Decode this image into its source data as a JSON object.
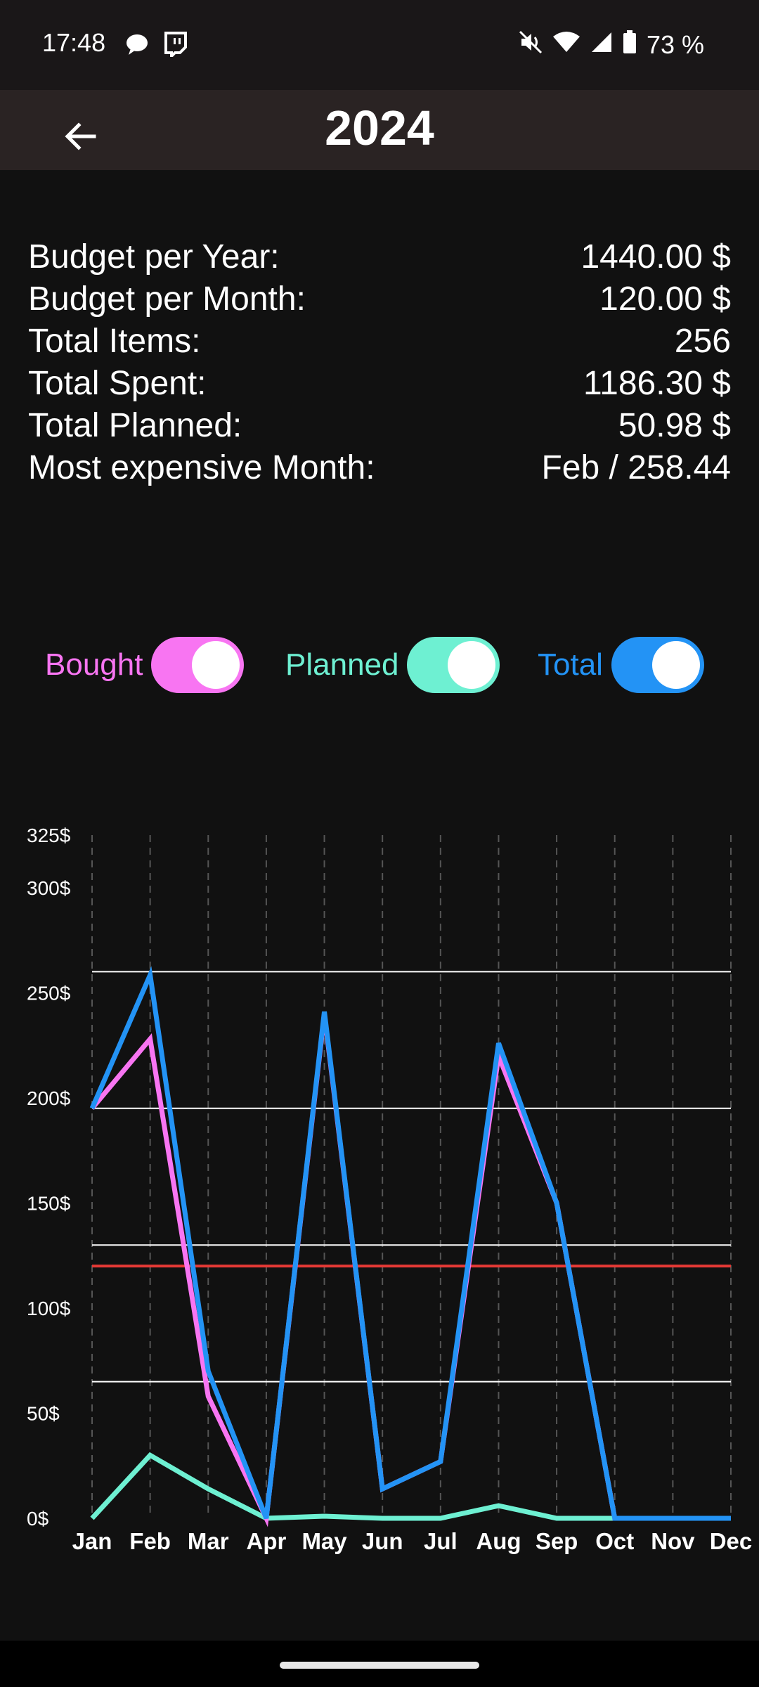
{
  "status": {
    "time": "17:48",
    "battery": "73 %"
  },
  "header": {
    "title": "2024",
    "back_icon": "arrow-left-icon"
  },
  "stats": [
    {
      "label": "Budget per Year:",
      "value": "1440.00 $"
    },
    {
      "label": "Budget per Month:",
      "value": "120.00 $"
    },
    {
      "label": "Total Items:",
      "value": "256"
    },
    {
      "label": "Total Spent:",
      "value": "1186.30 $"
    },
    {
      "label": "Total Planned:",
      "value": "50.98 $"
    },
    {
      "label": "Most expensive Month:",
      "value": "Feb / 258.44"
    }
  ],
  "toggles": [
    {
      "label": "Bought",
      "on": true,
      "color": "#f875f2",
      "track": "#f875f2"
    },
    {
      "label": "Planned",
      "on": true,
      "color": "#6ef0d2",
      "track": "#6ef0d2"
    },
    {
      "label": "Total",
      "on": true,
      "color": "#2393f5",
      "track": "#2393f5"
    }
  ],
  "colors": {
    "bought": "#f875f2",
    "planned": "#6ef0d2",
    "total": "#2393f5",
    "budget_line": "#e53935"
  },
  "chart_data": {
    "type": "line",
    "x": [
      "Jan",
      "Feb",
      "Mar",
      "Apr",
      "May",
      "Jun",
      "Jul",
      "Aug",
      "Sep",
      "Oct",
      "Nov",
      "Dec"
    ],
    "ylim": [
      0,
      325
    ],
    "y_ticks": [
      "0$",
      "50$",
      "100$",
      "150$",
      "200$",
      "250$",
      "300$",
      "325$"
    ],
    "y_tick_values": [
      0,
      50,
      100,
      150,
      200,
      250,
      300,
      325
    ],
    "reference_lines": [
      65,
      130,
      195,
      260
    ],
    "budget_line": 120,
    "grid": true,
    "series": [
      {
        "name": "Bought",
        "values": [
          195,
          228,
          58,
          0,
          240,
          14,
          27,
          220,
          150,
          0,
          0,
          0
        ]
      },
      {
        "name": "Planned",
        "values": [
          0,
          30,
          14,
          0,
          1,
          0,
          0,
          6,
          0,
          0,
          0,
          0
        ]
      },
      {
        "name": "Total",
        "values": [
          195,
          258.44,
          70,
          0,
          241,
          14,
          27,
          226,
          150,
          0,
          0,
          0
        ]
      }
    ]
  }
}
